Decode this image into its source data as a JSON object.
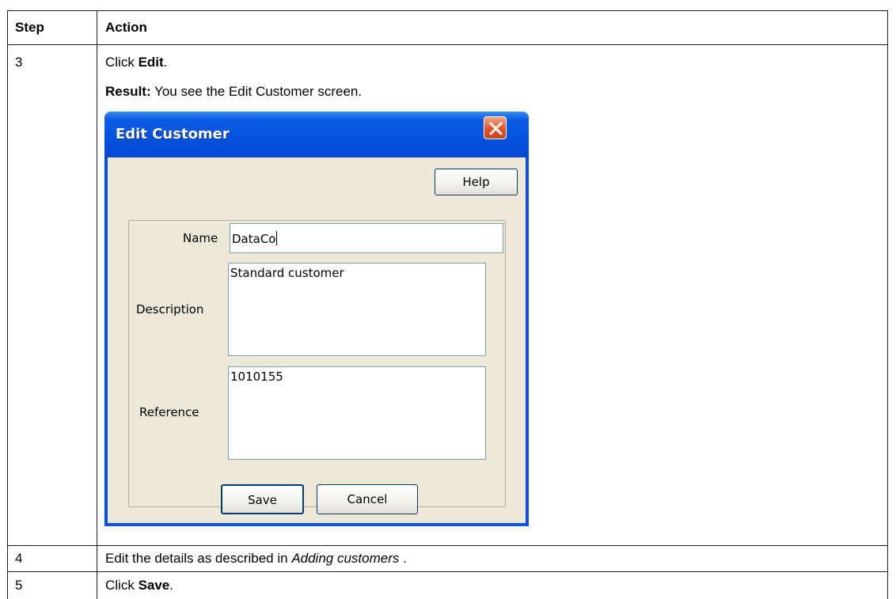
{
  "table": {
    "headers": {
      "step": "Step",
      "action": "Action"
    },
    "rows": [
      {
        "step": "3",
        "line1": {
          "prefix": "Click ",
          "bold": "Edit",
          "suffix": "."
        },
        "line2": {
          "bold": "Result:",
          "text": " You see the Edit Customer screen."
        }
      },
      {
        "step": "4",
        "line1": {
          "prefix": "Edit the details as described in ",
          "italic": "Adding customers",
          "suffix": " ."
        }
      },
      {
        "step": "5",
        "line1": {
          "prefix": "Click ",
          "bold": "Save",
          "suffix": "."
        }
      }
    ]
  },
  "dialog": {
    "title": "Edit Customer",
    "help_label": "Help",
    "fields": {
      "name": {
        "label": "Name",
        "value": "DataCo"
      },
      "description": {
        "label": "Description",
        "value": "Standard customer"
      },
      "reference": {
        "label": "Reference",
        "value": "1010155"
      }
    },
    "save_label": "Save",
    "cancel_label": "Cancel",
    "icons": {
      "close": "close-icon"
    },
    "colors": {
      "titlebar": "#0552e0",
      "close_button": "#e0542a",
      "client": "#ece9d8"
    }
  }
}
